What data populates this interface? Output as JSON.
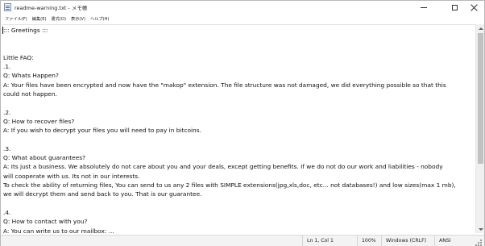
{
  "window": {
    "title": "readme-warning.txt - メモ帳",
    "icon": "notepad-icon"
  },
  "menu": [
    "ファイル(F)",
    "編集(E)",
    "書式(O)",
    "表示(V)",
    "ヘルプ(H)"
  ],
  "document": {
    "lines": [
      "::: Greetings :::",
      "",
      "",
      "Little FAQ:",
      ".1.",
      "Q: Whats Happen?",
      "A: Your files have been encrypted and now have the \"makop\" extension. The file structure was not damaged, we did everything possible so that this",
      "could not happen.",
      "",
      ".2.",
      "Q: How to recover files?",
      "A: If you wish to decrypt your files you will need to pay in bitcoins.",
      "",
      ".3.",
      "Q: What about guarantees?",
      "A: Its just a business. We absolutely do not care about you and your deals, except getting benefits. If we do not do our work and liabilities - nobody",
      "will cooperate with us. Its not in our interests.",
      "To check the ability of returning files, You can send to us any 2 files with SIMPLE extensions(jpg,xls,doc, etc... not databases!) and low sizes(max 1 mb),",
      "we will decrypt them and send back to you. That is our guarantee.",
      "",
      ".4.",
      "Q: How to contact with you?",
      "A: You can write us to our mailbox: ..."
    ]
  },
  "status": {
    "position": "Ln 1, Col 1",
    "zoom": "100%",
    "line_ending": "Windows (CRLF)",
    "encoding": "ANSI"
  }
}
